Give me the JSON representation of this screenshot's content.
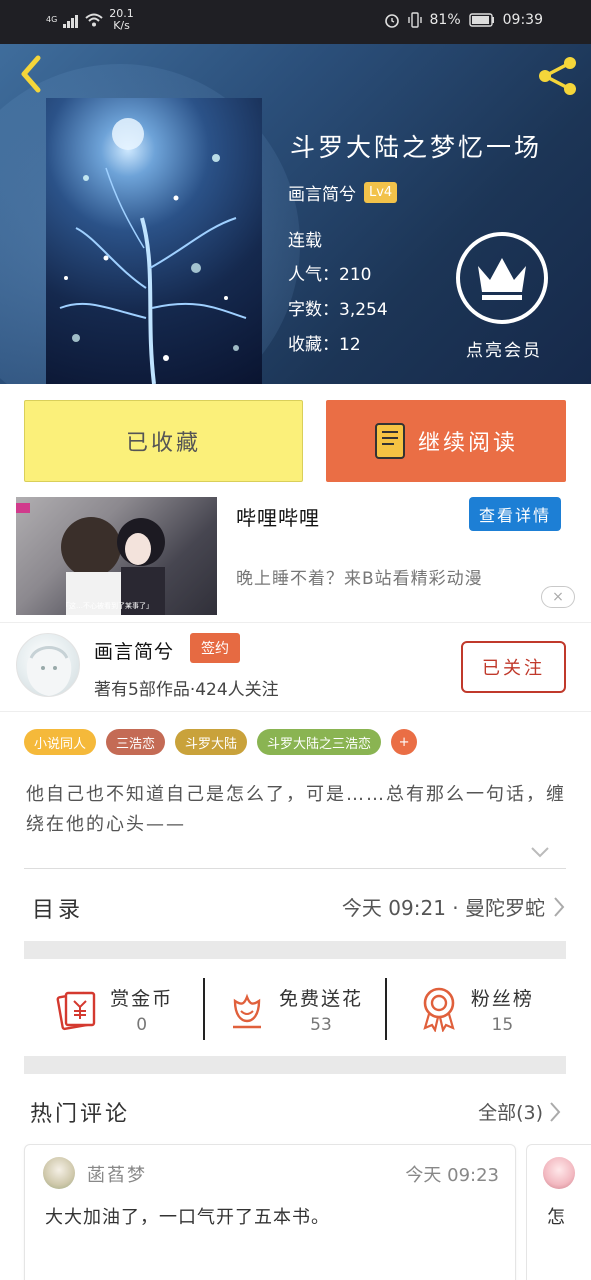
{
  "status_bar": {
    "network": "4G",
    "speed": "20.1",
    "speed_unit": "K/s",
    "battery": "81%",
    "time": "09:39"
  },
  "book": {
    "title": "斗罗大陆之梦忆一场",
    "author": "画言简兮",
    "level": "Lv4",
    "status": "连载",
    "popularity": "人气：210",
    "word_count": "字数：3,254",
    "favorites": "收藏：12"
  },
  "vip": {
    "label": "点亮会员"
  },
  "actions": {
    "favorited_label": "已收藏",
    "continue_label": "继续阅读"
  },
  "ad": {
    "title": "哔哩哔哩",
    "detail_label": "查看详情",
    "description": "晚上睡不着？来B站看精彩动漫",
    "close_icon": "×",
    "image_caption": "「这…不心被看到了某事了」"
  },
  "author_card": {
    "name": "画言简兮",
    "sign_badge": "签约",
    "stats": "著有5部作品·424人关注",
    "follow_label": "已关注"
  },
  "tags": [
    {
      "label": "小说同人",
      "color": "#f5b93a"
    },
    {
      "label": "三浩恋",
      "color": "#c46b55"
    },
    {
      "label": "斗罗大陆",
      "color": "#c9a23b"
    },
    {
      "label": "斗罗大陆之三浩恋",
      "color": "#8ab452"
    },
    {
      "label": "+",
      "color": "#ea6e45"
    }
  ],
  "intro": "他自己也不知道自己是怎么了，可是……总有那么一句话，缠绕在他的心头——",
  "toc": {
    "title": "目录",
    "latest": "今天 09:21 · 曼陀罗蛇"
  },
  "stats": {
    "reward": {
      "label": "赏金币",
      "value": "0"
    },
    "flower": {
      "label": "免费送花",
      "value": "53"
    },
    "fans": {
      "label": "粉丝榜",
      "value": "15"
    }
  },
  "comments": {
    "title": "热门评论",
    "all_label": "全部(3)",
    "items": [
      {
        "user": "菡萏梦",
        "time": "今天 09:23",
        "text": "大大加油了，一口气开了五本书。"
      },
      {
        "user": "",
        "time": "",
        "text": "怎"
      }
    ]
  },
  "colors": {
    "accent_orange": "#ea6e45",
    "fav_yellow": "#fbf07a",
    "link_blue": "#1d7fd5",
    "follow_red": "#c0392b"
  }
}
